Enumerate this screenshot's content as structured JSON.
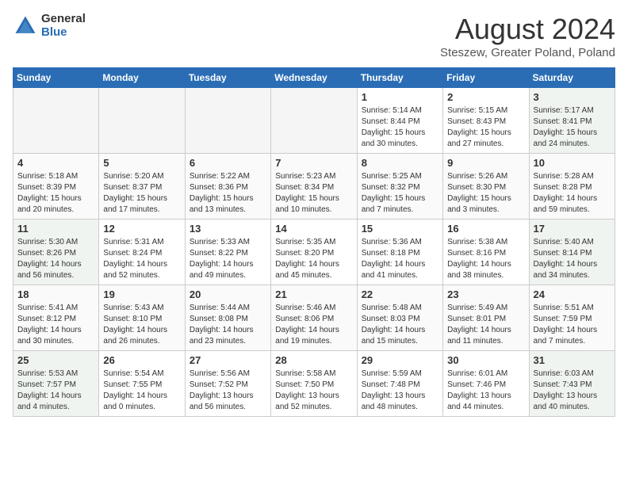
{
  "logo": {
    "general": "General",
    "blue": "Blue"
  },
  "title": "August 2024",
  "location": "Steszew, Greater Poland, Poland",
  "headers": [
    "Sunday",
    "Monday",
    "Tuesday",
    "Wednesday",
    "Thursday",
    "Friday",
    "Saturday"
  ],
  "weeks": [
    [
      {
        "day": "",
        "info": "",
        "empty": true
      },
      {
        "day": "",
        "info": "",
        "empty": true
      },
      {
        "day": "",
        "info": "",
        "empty": true
      },
      {
        "day": "",
        "info": "",
        "empty": true
      },
      {
        "day": "1",
        "info": "Sunrise: 5:14 AM\nSunset: 8:44 PM\nDaylight: 15 hours\nand 30 minutes.",
        "empty": false
      },
      {
        "day": "2",
        "info": "Sunrise: 5:15 AM\nSunset: 8:43 PM\nDaylight: 15 hours\nand 27 minutes.",
        "empty": false
      },
      {
        "day": "3",
        "info": "Sunrise: 5:17 AM\nSunset: 8:41 PM\nDaylight: 15 hours\nand 24 minutes.",
        "empty": false
      }
    ],
    [
      {
        "day": "4",
        "info": "Sunrise: 5:18 AM\nSunset: 8:39 PM\nDaylight: 15 hours\nand 20 minutes.",
        "empty": false
      },
      {
        "day": "5",
        "info": "Sunrise: 5:20 AM\nSunset: 8:37 PM\nDaylight: 15 hours\nand 17 minutes.",
        "empty": false
      },
      {
        "day": "6",
        "info": "Sunrise: 5:22 AM\nSunset: 8:36 PM\nDaylight: 15 hours\nand 13 minutes.",
        "empty": false
      },
      {
        "day": "7",
        "info": "Sunrise: 5:23 AM\nSunset: 8:34 PM\nDaylight: 15 hours\nand 10 minutes.",
        "empty": false
      },
      {
        "day": "8",
        "info": "Sunrise: 5:25 AM\nSunset: 8:32 PM\nDaylight: 15 hours\nand 7 minutes.",
        "empty": false
      },
      {
        "day": "9",
        "info": "Sunrise: 5:26 AM\nSunset: 8:30 PM\nDaylight: 15 hours\nand 3 minutes.",
        "empty": false
      },
      {
        "day": "10",
        "info": "Sunrise: 5:28 AM\nSunset: 8:28 PM\nDaylight: 14 hours\nand 59 minutes.",
        "empty": false
      }
    ],
    [
      {
        "day": "11",
        "info": "Sunrise: 5:30 AM\nSunset: 8:26 PM\nDaylight: 14 hours\nand 56 minutes.",
        "empty": false
      },
      {
        "day": "12",
        "info": "Sunrise: 5:31 AM\nSunset: 8:24 PM\nDaylight: 14 hours\nand 52 minutes.",
        "empty": false
      },
      {
        "day": "13",
        "info": "Sunrise: 5:33 AM\nSunset: 8:22 PM\nDaylight: 14 hours\nand 49 minutes.",
        "empty": false
      },
      {
        "day": "14",
        "info": "Sunrise: 5:35 AM\nSunset: 8:20 PM\nDaylight: 14 hours\nand 45 minutes.",
        "empty": false
      },
      {
        "day": "15",
        "info": "Sunrise: 5:36 AM\nSunset: 8:18 PM\nDaylight: 14 hours\nand 41 minutes.",
        "empty": false
      },
      {
        "day": "16",
        "info": "Sunrise: 5:38 AM\nSunset: 8:16 PM\nDaylight: 14 hours\nand 38 minutes.",
        "empty": false
      },
      {
        "day": "17",
        "info": "Sunrise: 5:40 AM\nSunset: 8:14 PM\nDaylight: 14 hours\nand 34 minutes.",
        "empty": false
      }
    ],
    [
      {
        "day": "18",
        "info": "Sunrise: 5:41 AM\nSunset: 8:12 PM\nDaylight: 14 hours\nand 30 minutes.",
        "empty": false
      },
      {
        "day": "19",
        "info": "Sunrise: 5:43 AM\nSunset: 8:10 PM\nDaylight: 14 hours\nand 26 minutes.",
        "empty": false
      },
      {
        "day": "20",
        "info": "Sunrise: 5:44 AM\nSunset: 8:08 PM\nDaylight: 14 hours\nand 23 minutes.",
        "empty": false
      },
      {
        "day": "21",
        "info": "Sunrise: 5:46 AM\nSunset: 8:06 PM\nDaylight: 14 hours\nand 19 minutes.",
        "empty": false
      },
      {
        "day": "22",
        "info": "Sunrise: 5:48 AM\nSunset: 8:03 PM\nDaylight: 14 hours\nand 15 minutes.",
        "empty": false
      },
      {
        "day": "23",
        "info": "Sunrise: 5:49 AM\nSunset: 8:01 PM\nDaylight: 14 hours\nand 11 minutes.",
        "empty": false
      },
      {
        "day": "24",
        "info": "Sunrise: 5:51 AM\nSunset: 7:59 PM\nDaylight: 14 hours\nand 7 minutes.",
        "empty": false
      }
    ],
    [
      {
        "day": "25",
        "info": "Sunrise: 5:53 AM\nSunset: 7:57 PM\nDaylight: 14 hours\nand 4 minutes.",
        "empty": false
      },
      {
        "day": "26",
        "info": "Sunrise: 5:54 AM\nSunset: 7:55 PM\nDaylight: 14 hours\nand 0 minutes.",
        "empty": false
      },
      {
        "day": "27",
        "info": "Sunrise: 5:56 AM\nSunset: 7:52 PM\nDaylight: 13 hours\nand 56 minutes.",
        "empty": false
      },
      {
        "day": "28",
        "info": "Sunrise: 5:58 AM\nSunset: 7:50 PM\nDaylight: 13 hours\nand 52 minutes.",
        "empty": false
      },
      {
        "day": "29",
        "info": "Sunrise: 5:59 AM\nSunset: 7:48 PM\nDaylight: 13 hours\nand 48 minutes.",
        "empty": false
      },
      {
        "day": "30",
        "info": "Sunrise: 6:01 AM\nSunset: 7:46 PM\nDaylight: 13 hours\nand 44 minutes.",
        "empty": false
      },
      {
        "day": "31",
        "info": "Sunrise: 6:03 AM\nSunset: 7:43 PM\nDaylight: 13 hours\nand 40 minutes.",
        "empty": false
      }
    ]
  ]
}
